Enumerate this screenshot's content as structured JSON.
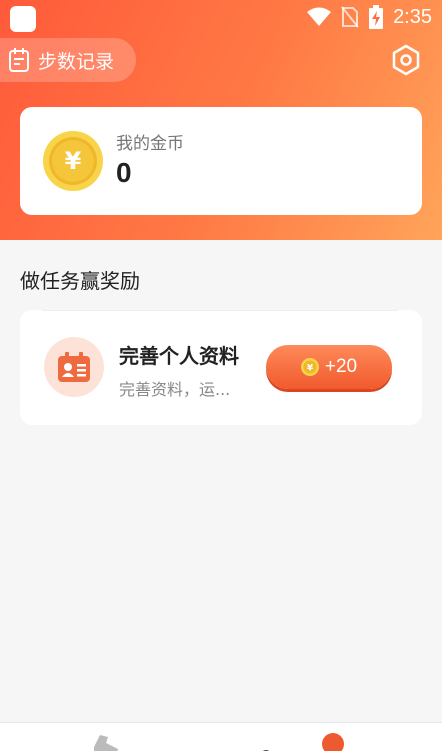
{
  "status_bar": {
    "time": "2:35"
  },
  "header": {
    "steps_label": "步数记录"
  },
  "coin_card": {
    "title": "我的金币",
    "value": "0"
  },
  "section": {
    "title": "做任务赢奖励"
  },
  "tasks": [
    {
      "title": "完善个人资料",
      "description": "完善资料，运...",
      "reward": "+20"
    }
  ],
  "colors": {
    "accent": "#ff5a3a",
    "reward_button": "#f05a2c",
    "coin_gold": "#f5c32c"
  }
}
